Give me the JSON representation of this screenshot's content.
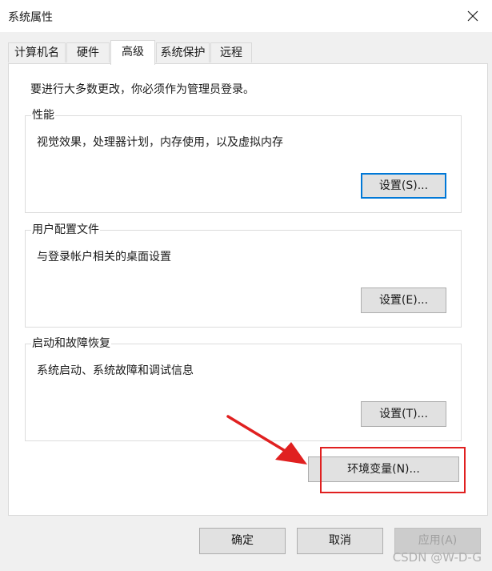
{
  "window": {
    "title": "系统属性"
  },
  "tabs": [
    {
      "label": "计算机名"
    },
    {
      "label": "硬件"
    },
    {
      "label": "高级",
      "active": true
    },
    {
      "label": "系统保护"
    },
    {
      "label": "远程"
    }
  ],
  "advanced": {
    "admin_note": "要进行大多数更改，你必须作为管理员登录。",
    "performance": {
      "label": "性能",
      "description": "视觉效果，处理器计划，内存使用，以及虚拟内存",
      "button": "设置(S)..."
    },
    "profiles": {
      "label": "用户配置文件",
      "description": "与登录帐户相关的桌面设置",
      "button": "设置(E)..."
    },
    "startup": {
      "label": "启动和故障恢复",
      "description": "系统启动、系统故障和调试信息",
      "button": "设置(T)..."
    },
    "env_button": "环境变量(N)..."
  },
  "footer": {
    "ok": "确定",
    "cancel": "取消",
    "apply": "应用(A)"
  },
  "watermark": "CSDN @W-D-G",
  "colors": {
    "accent": "#0078d7",
    "annotation": "#e02020"
  },
  "icons": {
    "close": "close-icon",
    "arrow": "annotation-arrow-icon"
  }
}
